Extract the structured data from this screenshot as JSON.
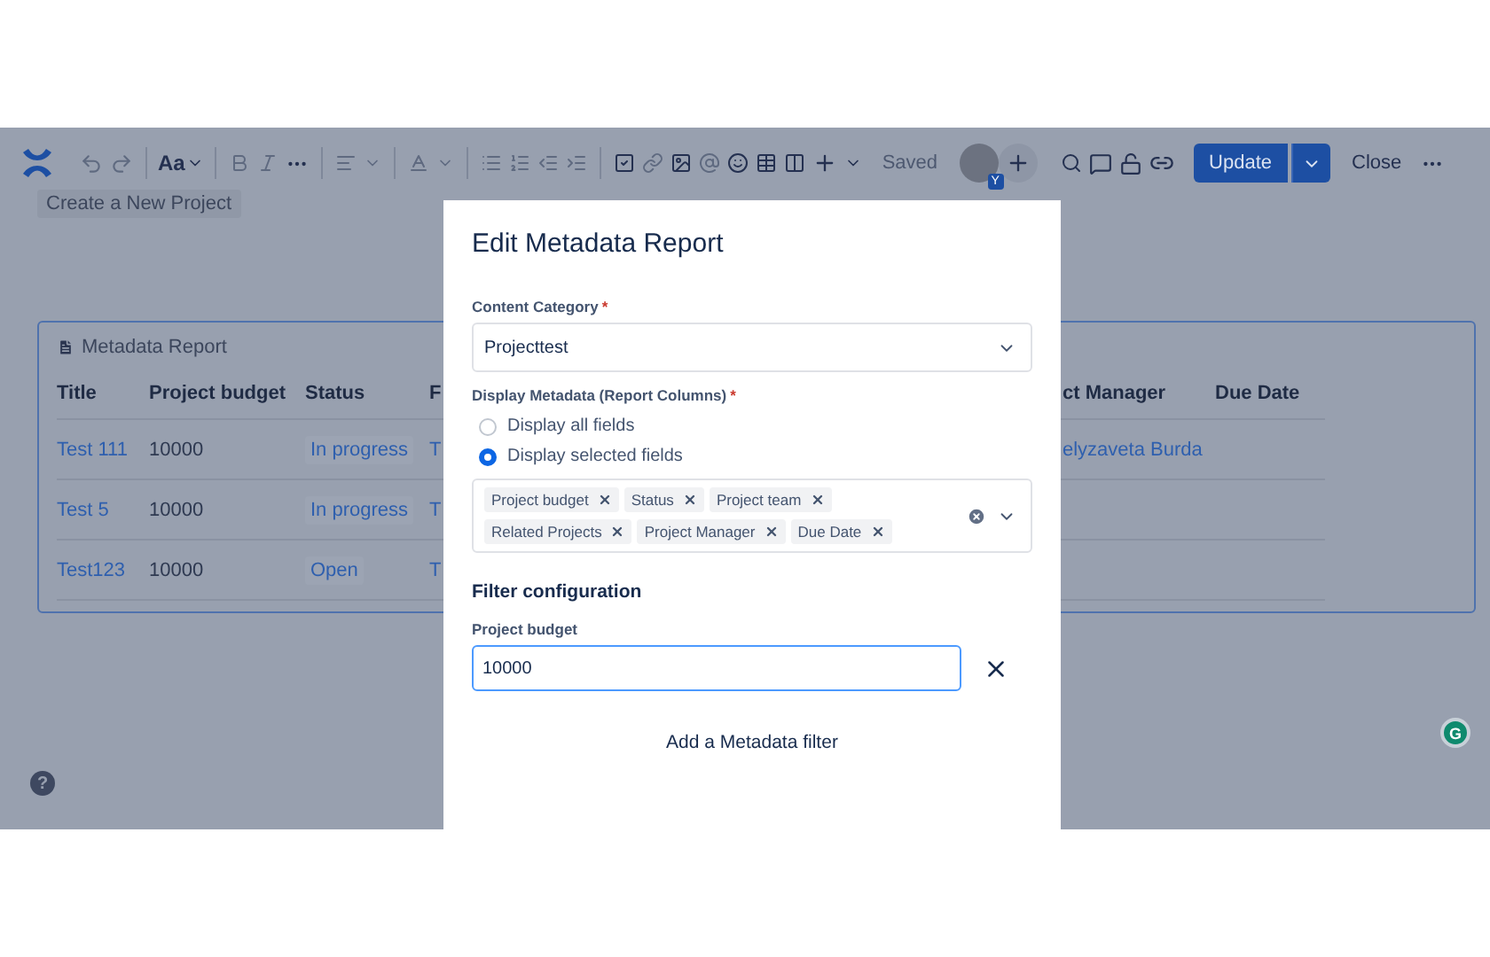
{
  "toolbar": {
    "font_menu": "Aa",
    "status": "Saved",
    "avatar_badge": "Y",
    "update": "Update",
    "close": "Close"
  },
  "page": {
    "create_button": "Create a New Project",
    "help": "?",
    "assistant_badge": "G"
  },
  "report": {
    "title": "Metadata Report",
    "columns": [
      "Title",
      "Project budget",
      "Status",
      "F",
      "ct Manager",
      "Due Date"
    ],
    "rows": [
      {
        "title": "Test 111",
        "budget": "10000",
        "status": "In progress",
        "column_4": "T",
        "manager": "elyzaveta Burda"
      },
      {
        "title": "Test 5",
        "budget": "10000",
        "status": "In progress",
        "column_4": "T"
      },
      {
        "title": "Test123",
        "budget": "10000",
        "status": "Open",
        "column_4": "T"
      }
    ]
  },
  "modal": {
    "title": "Edit Metadata Report",
    "category": {
      "label": "Content Category",
      "mark": "*",
      "value": "Projecttest"
    },
    "metadata": {
      "label": "Display Metadata (Report Columns)",
      "mark": "*",
      "options": [
        {
          "label": "Display all fields",
          "selected": false
        },
        {
          "label": "Display selected fields",
          "selected": true
        }
      ],
      "chips": [
        "Project budget",
        "Status",
        "Project team",
        "Related Projects",
        "Project Manager",
        "Due Date"
      ]
    },
    "filter": {
      "heading": "Filter configuration",
      "label": "Project budget",
      "value": "10000"
    },
    "add_filter": "Add a Metadata filter"
  }
}
